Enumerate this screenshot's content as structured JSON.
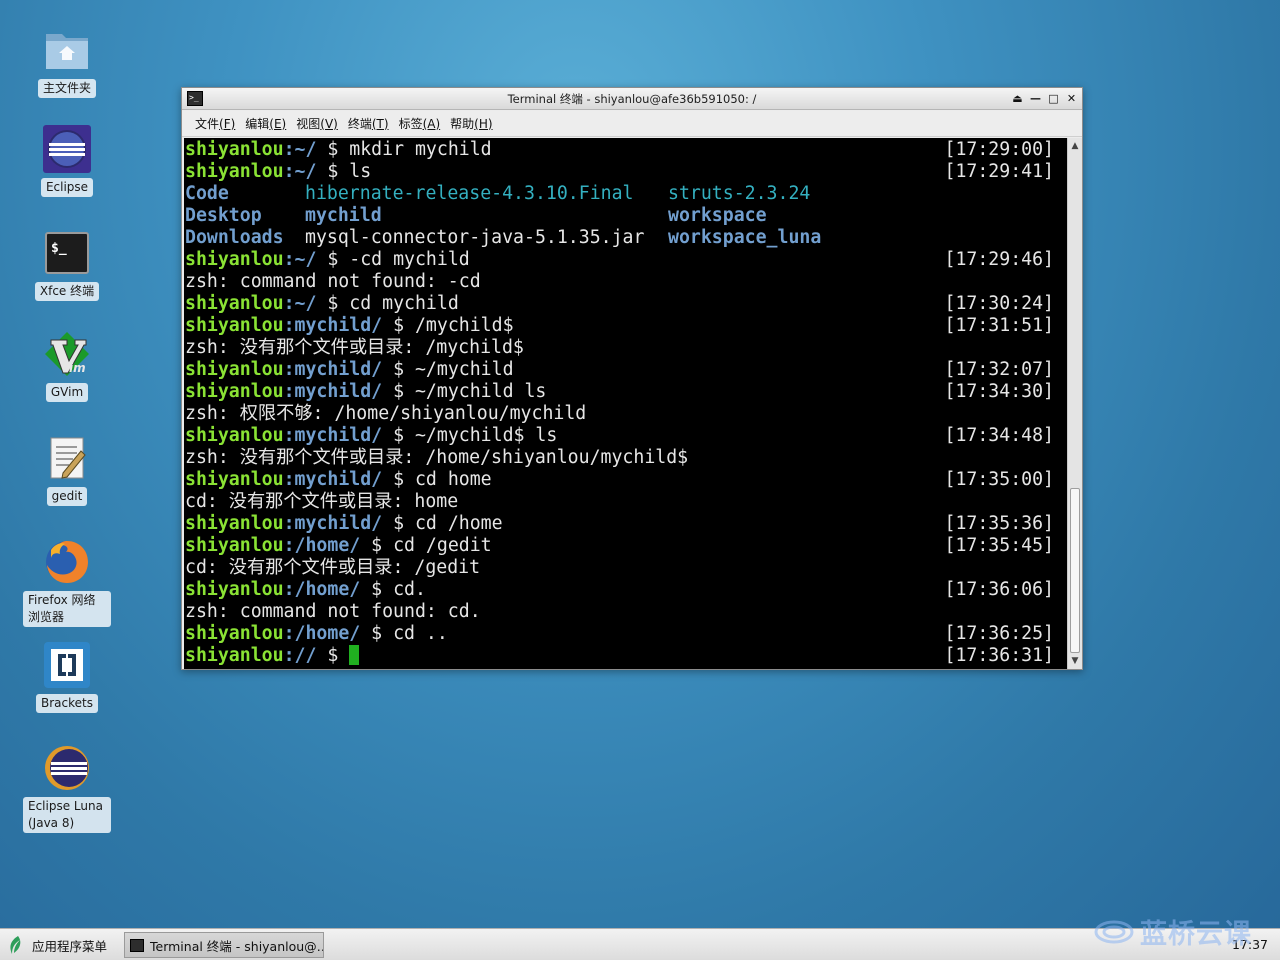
{
  "desktop": {
    "icons": [
      {
        "label": "主文件夹"
      },
      {
        "label": "Eclipse"
      },
      {
        "label": "Xfce 终端"
      },
      {
        "label": "GVim"
      },
      {
        "label": "gedit"
      },
      {
        "label": "Firefox 网络浏览器"
      },
      {
        "label": "Brackets"
      },
      {
        "label": "Eclipse Luna (Java 8)"
      }
    ]
  },
  "window": {
    "title": "Terminal 终端 - shiyanlou@afe36b591050: /",
    "menu": [
      {
        "text": "文件",
        "key": "(F)"
      },
      {
        "text": "编辑",
        "key": "(E)"
      },
      {
        "text": "视图",
        "key": "(V)"
      },
      {
        "text": "终端",
        "key": "(T)"
      },
      {
        "text": "标签",
        "key": "(A)"
      },
      {
        "text": "帮助",
        "key": "(H)"
      }
    ],
    "controls": {
      "shade": "⏏",
      "minimize": "—",
      "maximize": "□",
      "close": "✕"
    }
  },
  "terminal": {
    "user": "shiyanlou",
    "l1": {
      "path": "~/",
      "cmd": " $ mkdir mychild",
      "ts": "[17:29:00]"
    },
    "l2": {
      "path": "~/",
      "cmd": " $ ls",
      "ts": "[17:29:41]"
    },
    "ls_row1": {
      "a": "Code",
      "b": "hibernate-release-4.3.10.Final",
      "c": "struts-2.3.24"
    },
    "ls_row2": {
      "a": "Desktop",
      "b": "mychild",
      "c": "workspace"
    },
    "ls_row3": {
      "a": "Downloads",
      "b": "mysql-connector-java-5.1.35.jar",
      "c": "workspace_luna"
    },
    "l3": {
      "path": "~/",
      "cmd": " $ -cd mychild",
      "ts": "[17:29:46]"
    },
    "o3": "zsh: command not found: -cd",
    "l4": {
      "path": "~/",
      "cmd": " $ cd mychild",
      "ts": "[17:30:24]"
    },
    "l5": {
      "path": "mychild/",
      "cmd": " $ /mychild$",
      "ts": "[17:31:51]"
    },
    "o5": "zsh: 没有那个文件或目录: /mychild$",
    "l6": {
      "path": "mychild/",
      "cmd": " $ ~/mychild",
      "ts": "[17:32:07]"
    },
    "l7": {
      "path": "mychild/",
      "cmd": " $ ~/mychild ls",
      "ts": "[17:34:30]"
    },
    "o7": "zsh: 权限不够: /home/shiyanlou/mychild",
    "l8": {
      "path": "mychild/",
      "cmd": " $ ~/mychild$ ls",
      "ts": "[17:34:48]"
    },
    "o8": "zsh: 没有那个文件或目录: /home/shiyanlou/mychild$",
    "l9": {
      "path": "mychild/",
      "cmd": " $ cd home",
      "ts": "[17:35:00]"
    },
    "o9": "cd: 没有那个文件或目录: home",
    "l10": {
      "path": "mychild/",
      "cmd": " $ cd /home",
      "ts": "[17:35:36]"
    },
    "l11": {
      "path": "/home/",
      "cmd": " $ cd /gedit",
      "ts": "[17:35:45]"
    },
    "o11": "cd: 没有那个文件或目录: /gedit",
    "l12": {
      "path": "/home/",
      "cmd": " $ cd.",
      "ts": "[17:36:06]"
    },
    "o12": "zsh: command not found: cd.",
    "l13": {
      "path": "/home/",
      "cmd": " $ cd ..",
      "ts": "[17:36:25]"
    },
    "l14": {
      "path": "//",
      "cmd": " $ ",
      "ts": "[17:36:31]"
    }
  },
  "taskbar": {
    "apps_menu": "应用程序菜单",
    "task": "Terminal 终端 - shiyanlou@…",
    "watermark": "蓝桥云课",
    "clock": "17:37"
  },
  "colors": {
    "user": "#8ae234",
    "path": "#729fcf",
    "cursor": "#20b020"
  }
}
